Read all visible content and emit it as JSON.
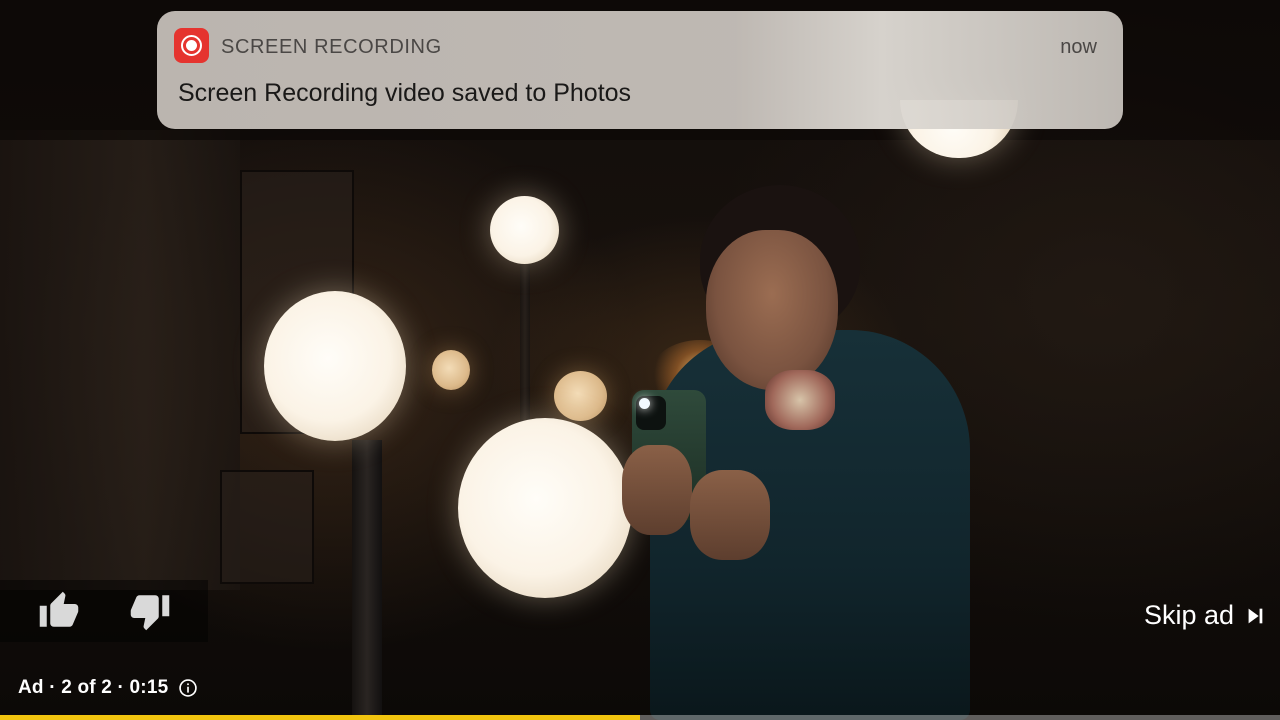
{
  "notification": {
    "app_name": "SCREEN RECORDING",
    "time": "now",
    "message": "Screen Recording video saved to Photos",
    "icon": "screen-recording-icon",
    "icon_color": "#e5342f"
  },
  "ad": {
    "status_text": "Ad · 2 of 2 · 0:15",
    "info_icon": "info-icon",
    "skip_label": "Skip ad",
    "skip_icon": "skip-next-icon",
    "like_icon": "thumbs-up-icon",
    "dislike_icon": "thumbs-down-icon",
    "progress_fraction": 0.5,
    "progress_color": "#f1c40f"
  }
}
